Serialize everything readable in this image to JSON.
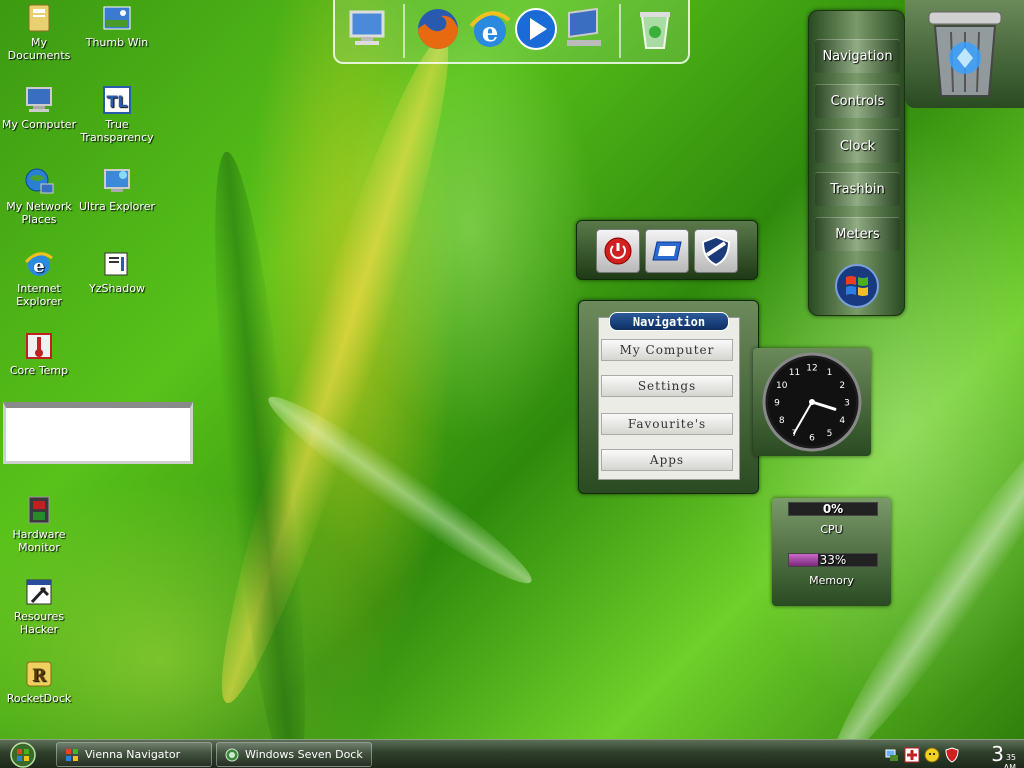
{
  "desktop_icons": [
    {
      "label": "My Documents"
    },
    {
      "label": "Thumb Win"
    },
    {
      "label": "My Computer"
    },
    {
      "label": "True Transparency"
    },
    {
      "label": "My Network Places"
    },
    {
      "label": "Ultra Explorer"
    },
    {
      "label": "Internet Explorer"
    },
    {
      "label": "YzShadow"
    },
    {
      "label": "Core Temp"
    },
    {
      "label": "Hardware Monitor"
    },
    {
      "label": "Resoures Hacker"
    },
    {
      "label": "RocketDock"
    }
  ],
  "top_dock": {
    "items": [
      "my-computer-icon",
      "firefox-icon",
      "internet-explorer-icon",
      "media-player-icon",
      "display-properties-icon",
      "recycle-bin-icon"
    ]
  },
  "side_menu": {
    "items": [
      "Navigation",
      "Controls",
      "Clock",
      "Trashbin",
      "Meters"
    ]
  },
  "navigation_widget": {
    "title": "Navigation",
    "buttons": [
      "My Computer",
      "Settings",
      "Favourite's",
      "Apps"
    ]
  },
  "clock_widget": {
    "numbers": [
      "12",
      "1",
      "2",
      "3",
      "4",
      "5",
      "6",
      "7",
      "8",
      "9",
      "10",
      "11"
    ],
    "hour": 3,
    "minute": 35
  },
  "meters": {
    "cpu_value": "0%",
    "cpu_label": "CPU",
    "cpu_percent": 0,
    "memory_value": "33%",
    "memory_label": "Memory",
    "memory_percent": 33
  },
  "taskbar": {
    "tasks": [
      "Vienna Navigator",
      "Windows Seven Dock"
    ],
    "clock_hour": "3",
    "clock_minutes": "35",
    "clock_ampm": "AM"
  },
  "colors": {
    "accent_green": "#58c21a",
    "nav_title": "#0d2e62",
    "memory_fill": "#c86ac8"
  }
}
